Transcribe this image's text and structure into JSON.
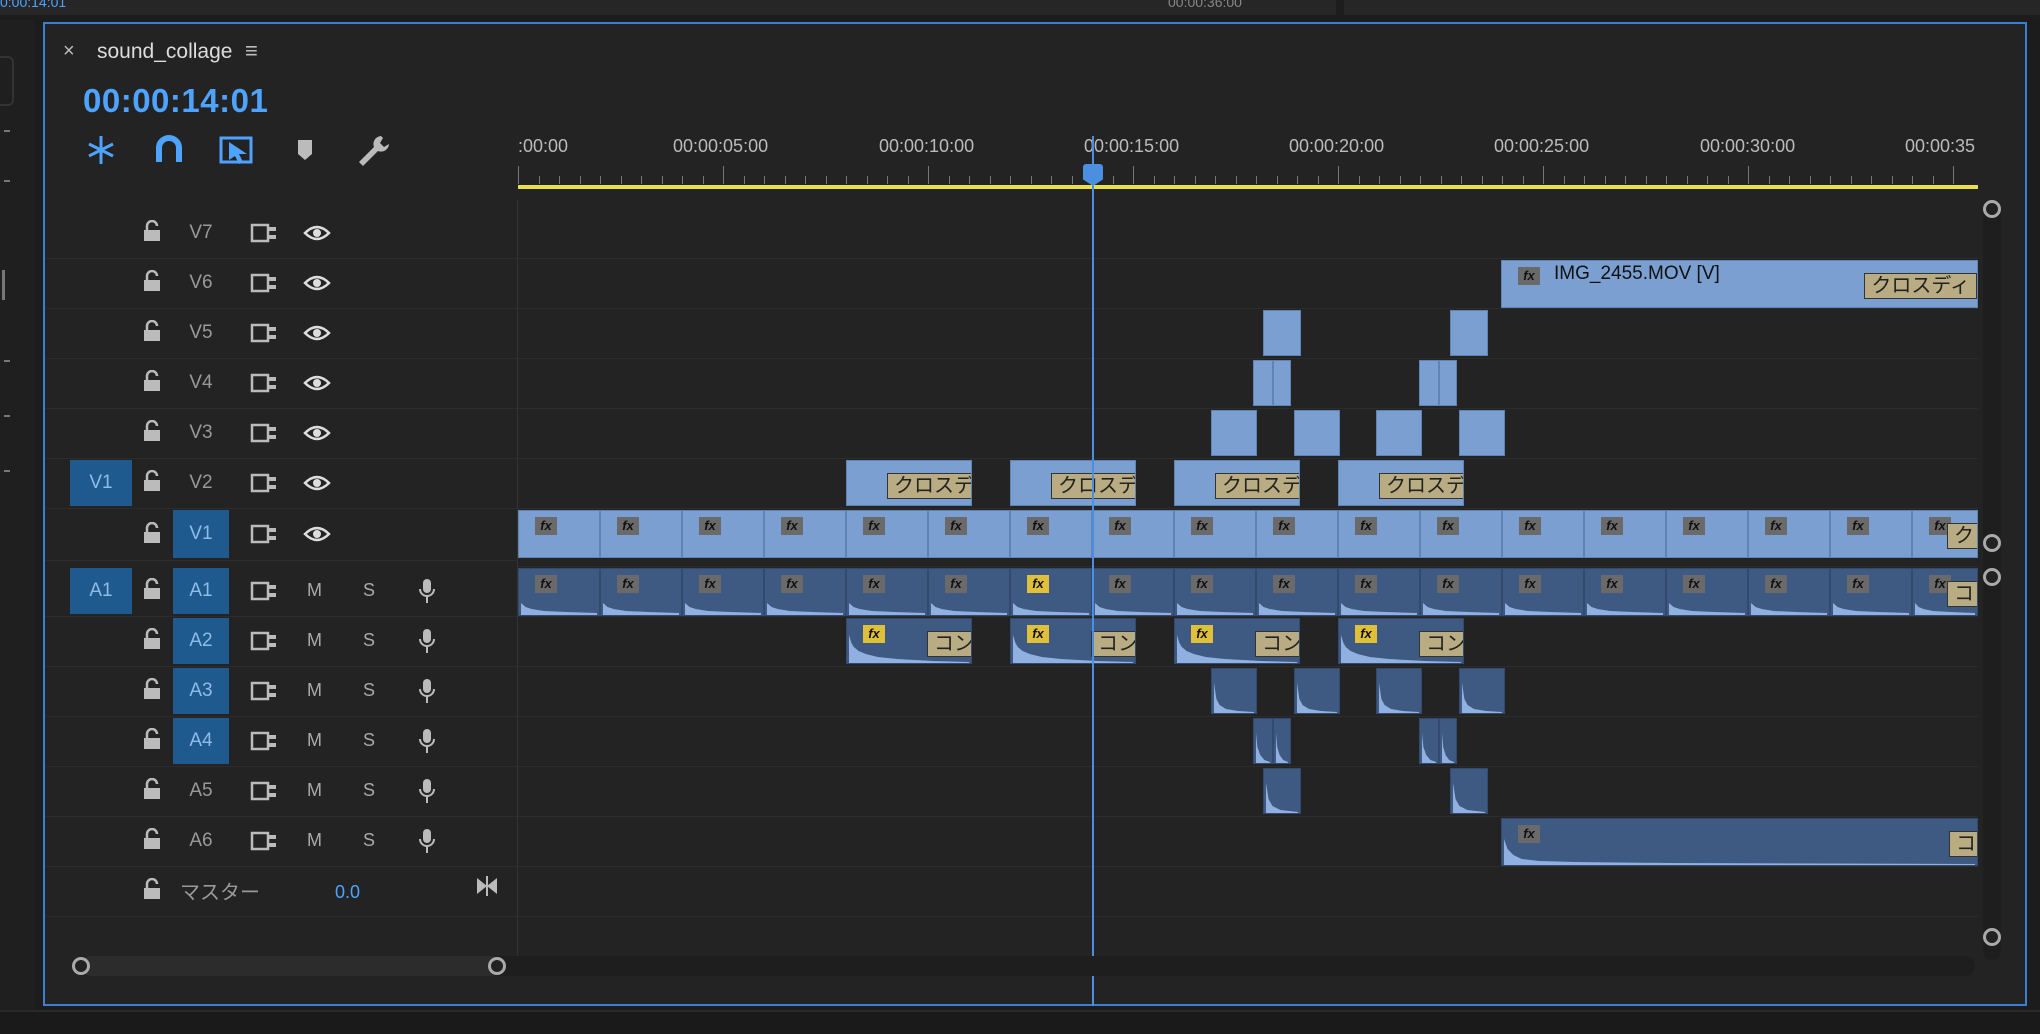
{
  "top_bar": {
    "timecode_left": "0:00:14:01",
    "timecode_right": "00:00:36:00"
  },
  "panel": {
    "title": "sequence",
    "close_glyph": "×",
    "menu_glyph": "≡",
    "sequence_name": "sound_collage",
    "timecode": "00:00:14:01"
  },
  "toolbar": {
    "items": [
      {
        "name": "insert-overwrite-icon",
        "color": "#4ea3ff"
      },
      {
        "name": "snap-magnet-icon",
        "color": "#4ea3ff"
      },
      {
        "name": "linked-selection-icon",
        "color": "#4ea3ff"
      },
      {
        "name": "add-marker-icon",
        "color": "#bbbbbb"
      },
      {
        "name": "wrench-settings-icon",
        "color": "#bbbbbb"
      }
    ]
  },
  "ruler": {
    "labels": [
      ":00:00",
      "00:00:05:00",
      "00:00:10:00",
      "00:00:15:00",
      "00:00:20:00",
      "00:00:25:00",
      "00:00:30:00",
      "00:00:35"
    ]
  },
  "video_tracks": [
    {
      "name": "V7",
      "source": ""
    },
    {
      "name": "V6",
      "source": ""
    },
    {
      "name": "V5",
      "source": ""
    },
    {
      "name": "V4",
      "source": ""
    },
    {
      "name": "V3",
      "source": ""
    },
    {
      "name": "V2",
      "source": "V1"
    },
    {
      "name": "V1",
      "source": "",
      "targeted": true
    }
  ],
  "audio_tracks": [
    {
      "name": "A1",
      "source": "A1",
      "targeted": true,
      "mute": "M",
      "solo": "S"
    },
    {
      "name": "A2",
      "source": "",
      "targeted": true,
      "mute": "M",
      "solo": "S"
    },
    {
      "name": "A3",
      "source": "",
      "targeted": true,
      "mute": "M",
      "solo": "S"
    },
    {
      "name": "A4",
      "source": "",
      "targeted": true,
      "mute": "M",
      "solo": "S"
    },
    {
      "name": "A5",
      "source": "",
      "targeted": false,
      "mute": "M",
      "solo": "S"
    },
    {
      "name": "A6",
      "source": "",
      "targeted": false,
      "mute": "M",
      "solo": "S"
    }
  ],
  "master": {
    "label": "マスター",
    "value": "0.0"
  },
  "clips": {
    "fx_label": "fx",
    "v6_clip_name": "IMG_2455.MOV [V]",
    "v6_transition": "クロスディ",
    "v2_transition": "クロスデ",
    "v1_end_transition": "ク",
    "a_transition": "コン",
    "a_end_transition": "コ"
  },
  "colors": {
    "accent": "#4ea3ff",
    "video_clip": "#7a9fd0",
    "audio_clip": "#3e5a82",
    "work_area": "#e6e04a",
    "track_target": "#1f5a8e"
  }
}
